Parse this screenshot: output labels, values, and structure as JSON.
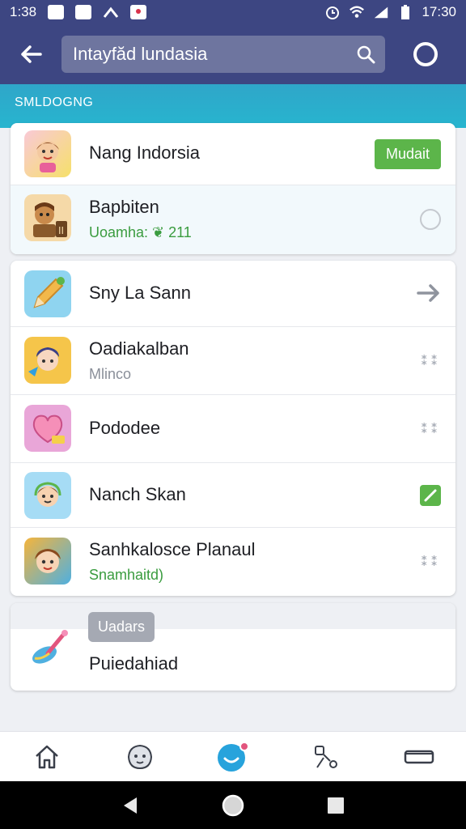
{
  "status_bar": {
    "time_left": "1:38",
    "time_right": "17:30"
  },
  "app_bar": {
    "search_text": "Intayfăd lundasia"
  },
  "section": {
    "title": "SMLDOGNG"
  },
  "group1": [
    {
      "title": "Nang Indorsia",
      "action_label": "Mudait"
    },
    {
      "title": "Bapbiten",
      "subtitle": "Uoamha: ❦ 211"
    }
  ],
  "group2": [
    {
      "title": "Sny La Sann"
    },
    {
      "title": "Oadiakalban",
      "subtitle": "Mlinco"
    },
    {
      "title": "Pododee"
    },
    {
      "title": "Nanch Skan"
    },
    {
      "title": "Sanhkalosce Planaul",
      "subtitle": "Snamhaitd)"
    }
  ],
  "bottom_card": {
    "chip": "Uadars",
    "label": "Puiedahiad"
  },
  "colors": {
    "primary": "#3d4682",
    "accent": "#27b5cf",
    "green": "#5cb54a"
  },
  "icons": {
    "nav": [
      "home-icon",
      "face-icon",
      "chat-bubble-icon",
      "share-icon",
      "card-icon"
    ]
  }
}
